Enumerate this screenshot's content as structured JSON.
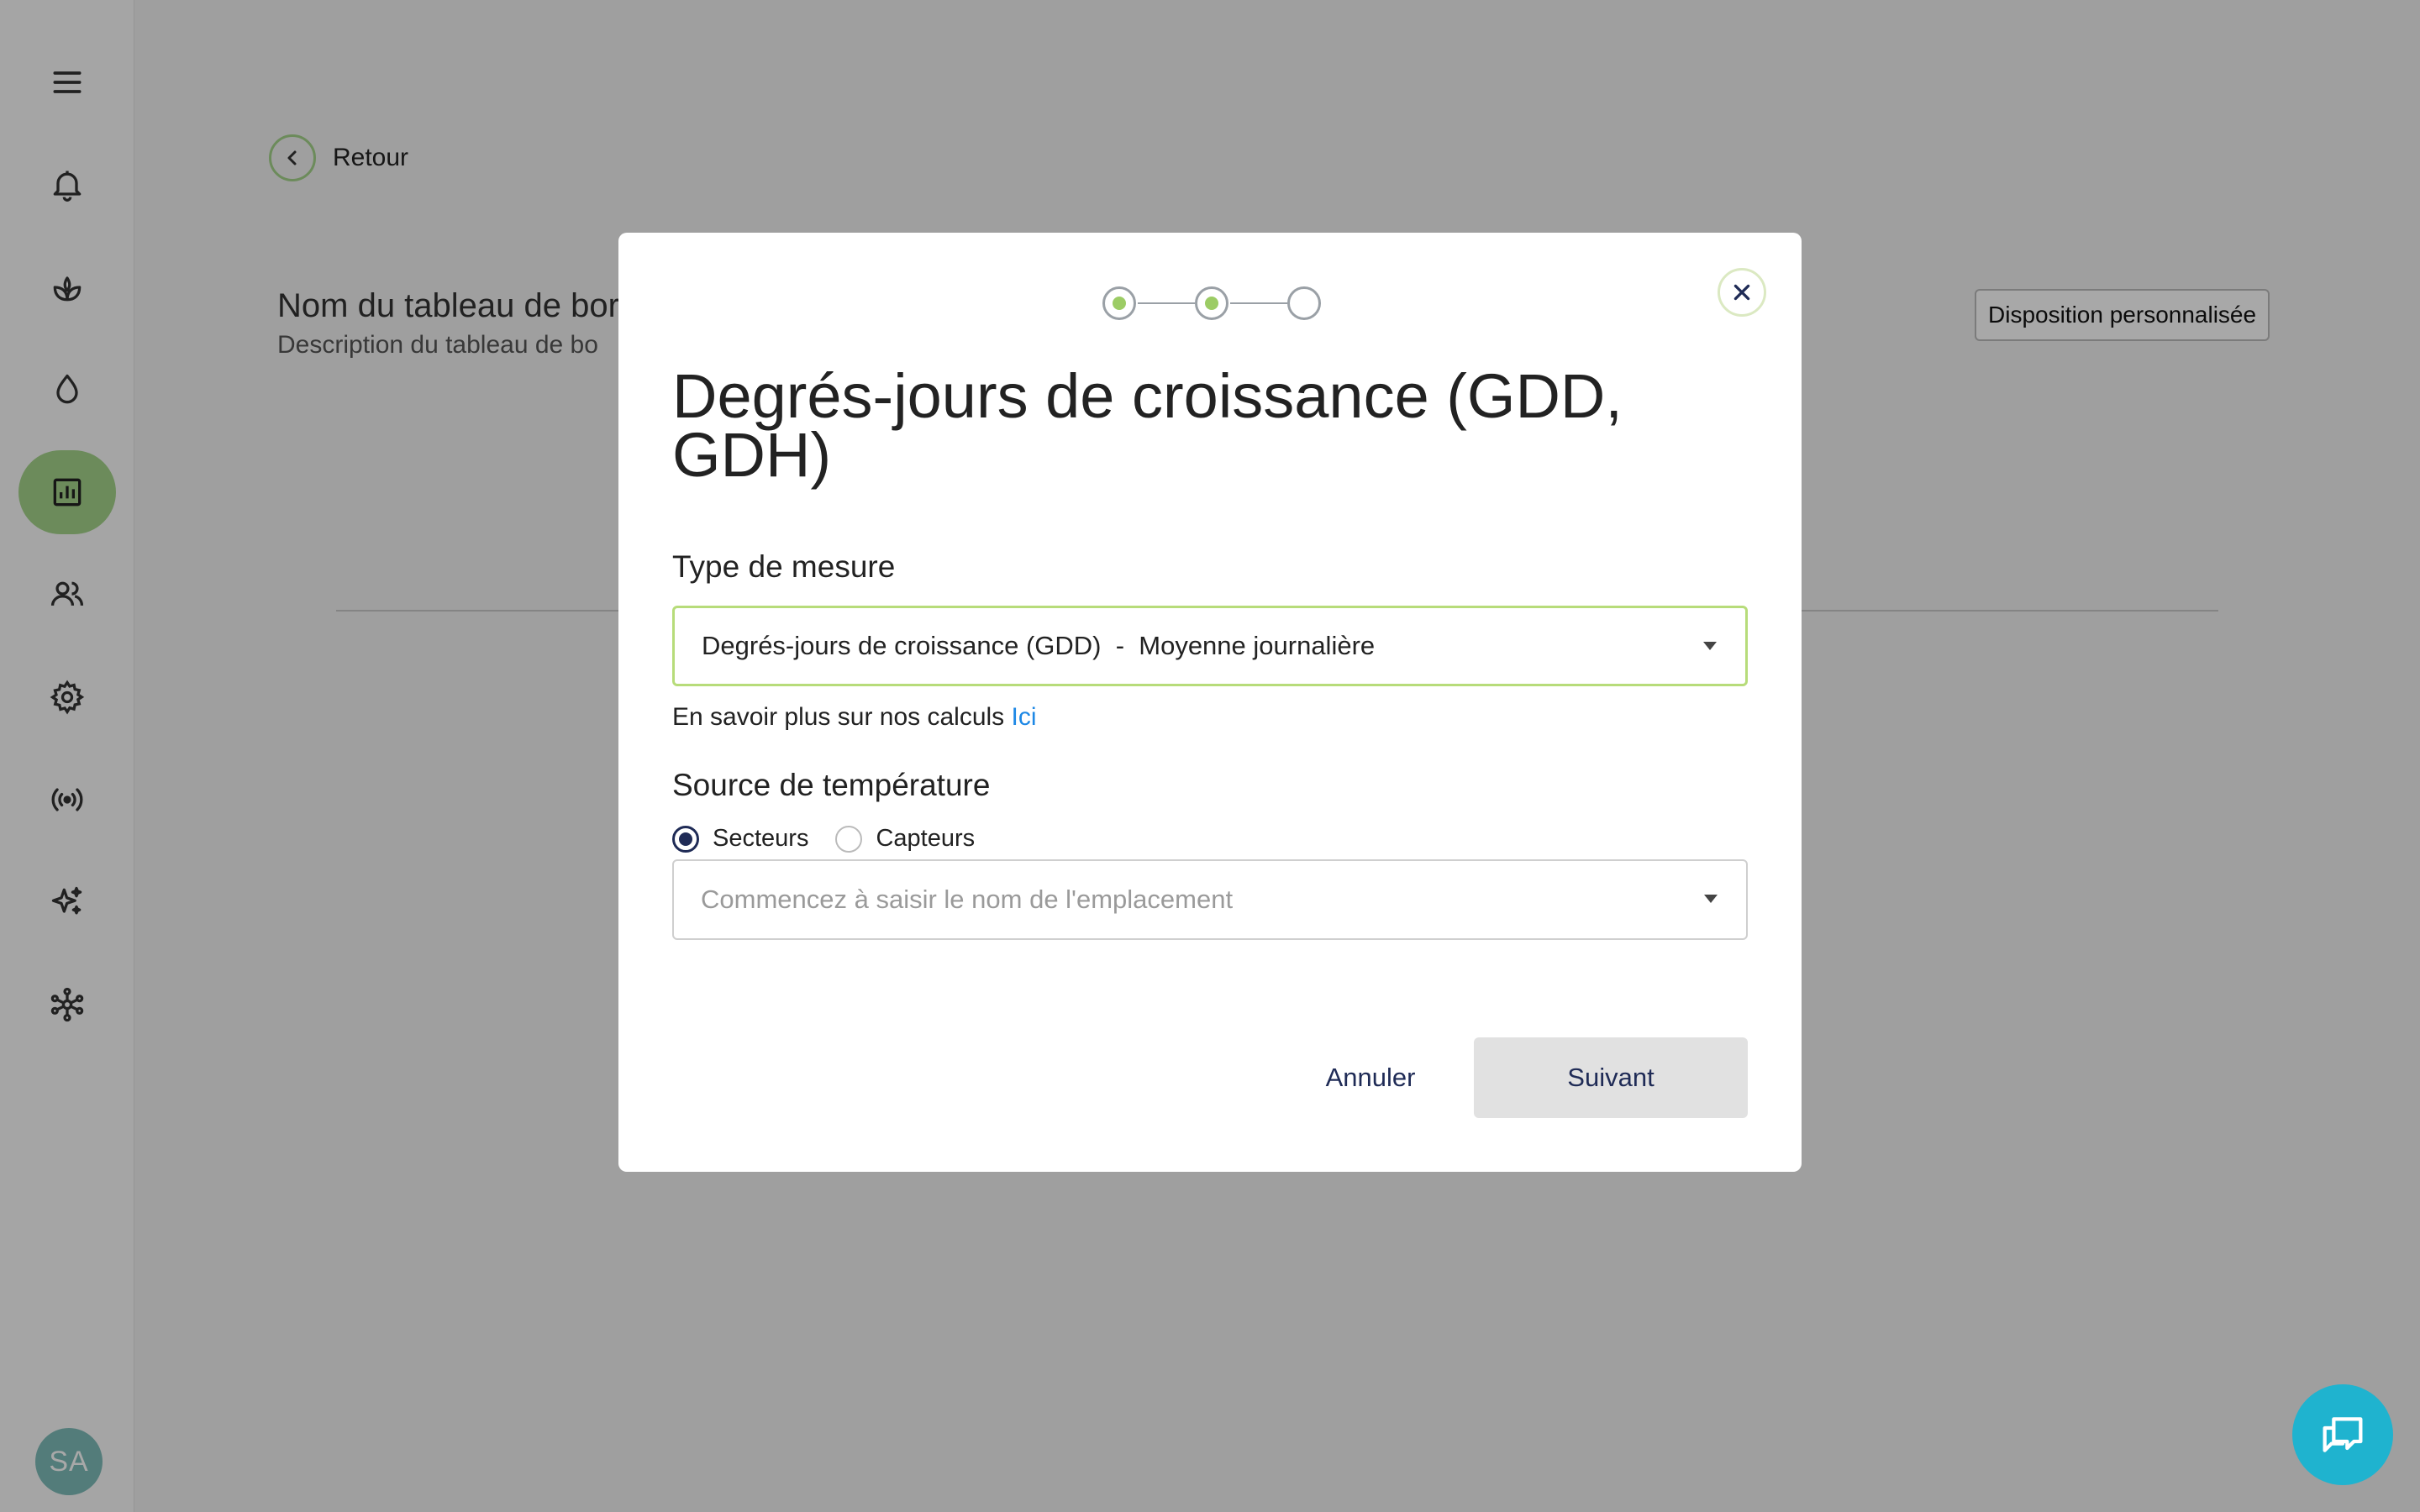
{
  "sidebar": {
    "items": [
      {
        "icon": "menu-icon"
      },
      {
        "icon": "bell-icon"
      },
      {
        "icon": "plant-icon"
      },
      {
        "icon": "water-drop-icon"
      },
      {
        "icon": "chart-icon",
        "active": true
      },
      {
        "icon": "users-icon"
      },
      {
        "icon": "gear-icon"
      },
      {
        "icon": "broadcast-icon"
      },
      {
        "icon": "sparkles-icon"
      },
      {
        "icon": "network-icon"
      }
    ],
    "avatar_initials": "SA"
  },
  "page": {
    "back_label": "Retour",
    "dashboard_title": "Nom du tableau de bor",
    "dashboard_description": "Description du tableau de bo",
    "custom_layout_label": "Disposition personnalisée"
  },
  "modal": {
    "steps": [
      {
        "state": "complete"
      },
      {
        "state": "current"
      },
      {
        "state": "upcoming"
      }
    ],
    "title": "Degrés-jours de croissance (GDD, GDH)",
    "measure_type_label": "Type de mesure",
    "measure_type_value": "Degrés-jours de croissance (GDD)  -  Moyenne journalière",
    "learn_more_text": "En savoir plus sur nos calculs ",
    "learn_more_link": "Ici",
    "temperature_source_label": "Source de température",
    "radio_options": [
      {
        "label": "Secteurs",
        "checked": true
      },
      {
        "label": "Capteurs",
        "checked": false
      }
    ],
    "location_placeholder": "Commencez à saisir le nom de l'emplacement",
    "cancel_label": "Annuler",
    "next_label": "Suivant"
  },
  "colors": {
    "accent_green": "#a4d48b",
    "navy": "#1f2b56",
    "link_blue": "#1e88e5",
    "chat_teal": "#1fb3cf"
  }
}
